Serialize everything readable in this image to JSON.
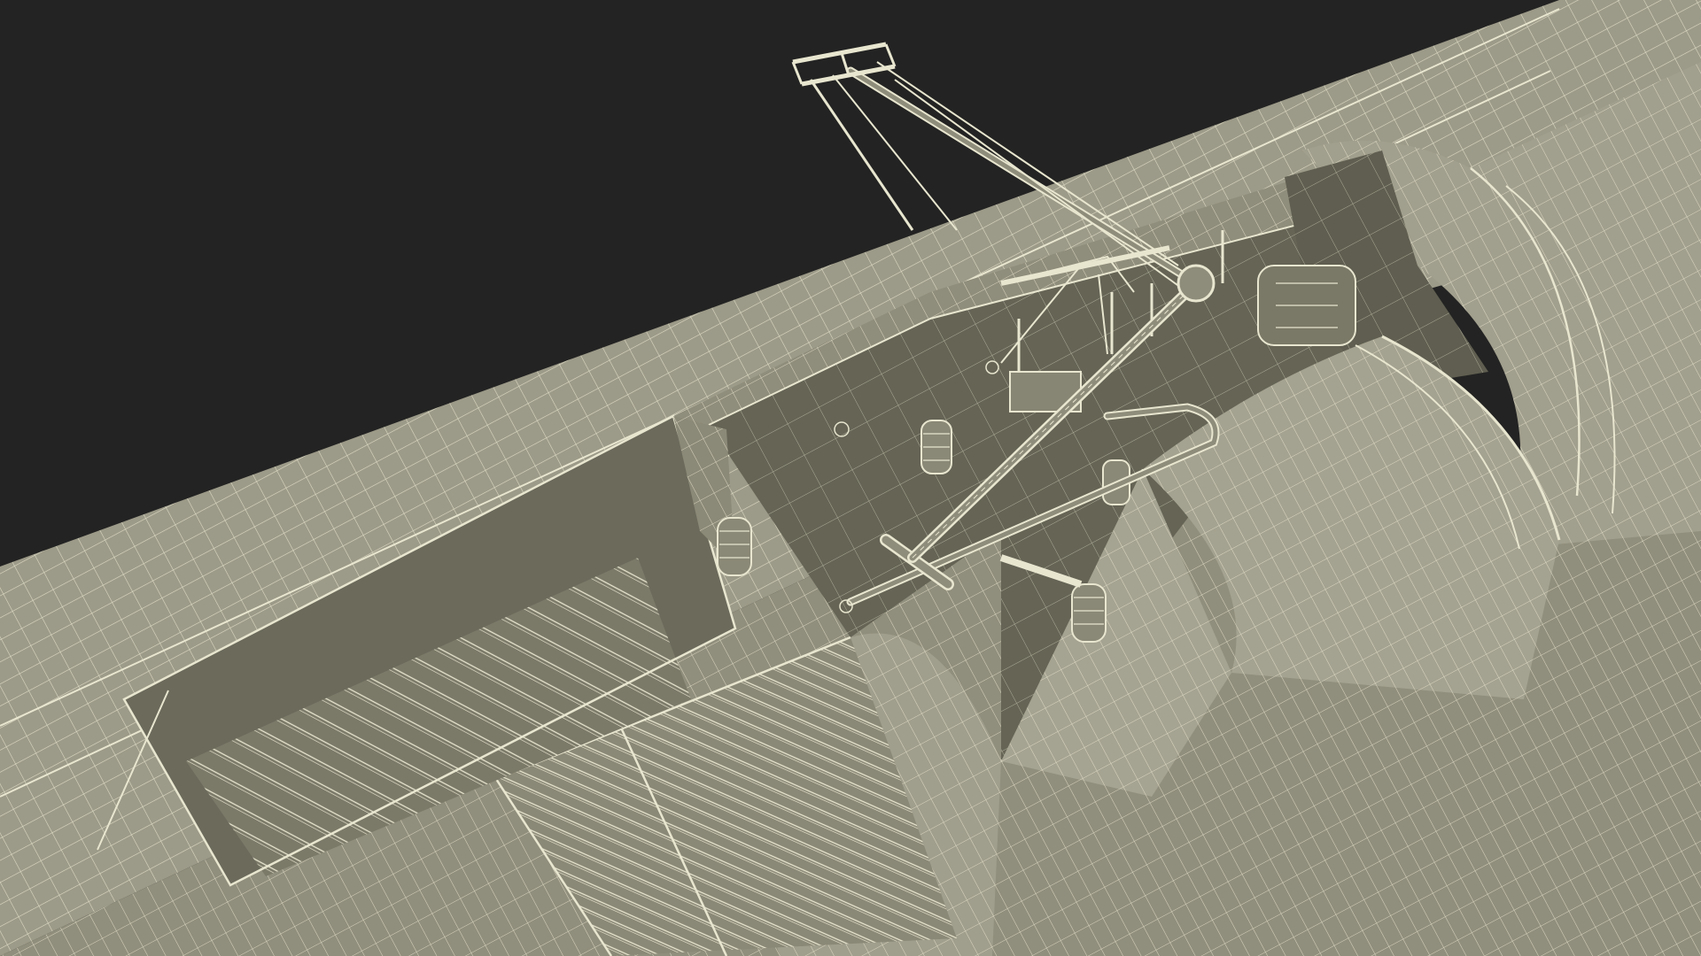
{
  "scene": {
    "subject": "",
    "colors": {
      "background": "#232323",
      "surface": "#8d8b79",
      "surface_light": "#a3a18f",
      "surface_dark": "#6e6c5d",
      "recess": "#5d5c4f",
      "wire": "#e8e6cf"
    }
  }
}
